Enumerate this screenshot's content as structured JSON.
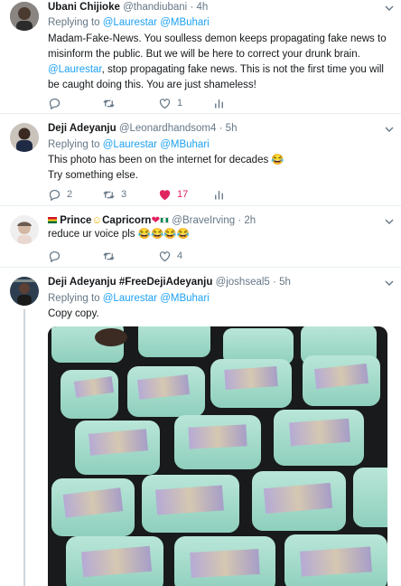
{
  "tweets": [
    {
      "name": "Ubani Chijioke",
      "handle": "@thandiubani",
      "time": "4h",
      "replying_prefix": "Replying to",
      "reply_to": [
        "@Laurestar",
        "@MBuhari"
      ],
      "text_parts": [
        "Madam-Fake-News. You soulless demon keeps propagating fake news to misinform the public. But we will be here to correct your drunk brain. ",
        "@Laurestar",
        ", stop propagating fake news. This is not the first time you will be caught doing this. You are just shameless!"
      ],
      "likes": "1",
      "replies": "",
      "retweets": ""
    },
    {
      "name": "Deji Adeyanju",
      "handle": "@Leonardhandsom4",
      "time": "5h",
      "replying_prefix": "Replying to",
      "reply_to": [
        "@Laurestar",
        "@MBuhari"
      ],
      "text_line1": "This photo has been on the internet for decades 😂",
      "text_line2": "Try something else.",
      "replies": "2",
      "retweets": "3",
      "likes": "17"
    },
    {
      "name_a": "Prince",
      "name_b": "Capricorn",
      "handle": "@BraveIrving",
      "time": "2h",
      "text": "reduce ur voice pls 😂😂😂😂",
      "likes": "4",
      "replies": "",
      "retweets": ""
    },
    {
      "name": "Deji Adeyanju #FreeDejiAdeyanju",
      "handle": "@joshseal5",
      "time": "5h",
      "replying_prefix": "Replying to",
      "reply_to": [
        "@Laurestar",
        "@MBuhari"
      ],
      "text": "Copy copy."
    }
  ],
  "separator": "·",
  "icons": [
    "reply-icon",
    "retweet-icon",
    "like-icon",
    "analytics-icon",
    "caret-down-icon"
  ],
  "colors": {
    "link": "#1da1f2",
    "muted": "#657786",
    "like": "#e0245e",
    "border": "#e6ecf0"
  }
}
